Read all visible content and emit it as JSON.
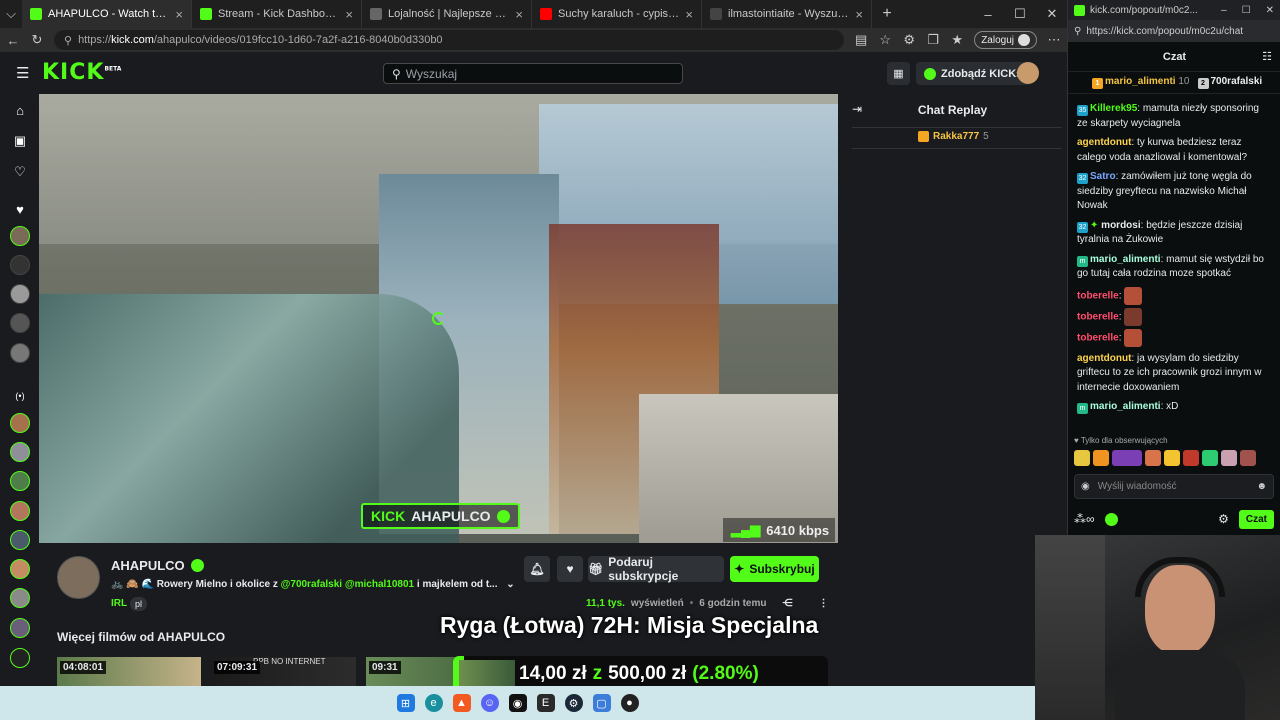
{
  "browser": {
    "tabs": [
      {
        "title": "AHAPULCO - Watch the VOD",
        "active": true,
        "color": "#53fc18"
      },
      {
        "title": "Stream - Kick Dashboard",
        "active": false,
        "color": "#53fc18"
      },
      {
        "title": "Lojalność | Najlepsze oprogramow",
        "active": false,
        "color": "#666666"
      },
      {
        "title": "Suchy karaluch - cypis - YouTube",
        "active": false,
        "color": "#ff0000"
      },
      {
        "title": "ilmastointiaite - Wyszukaj",
        "active": false,
        "color": "#444444"
      }
    ],
    "url": "https://kick.com/ahapulco/videos/019fcc10-1d60-7a2f-a216-8040b0d330b0",
    "url_prefix": "https://",
    "url_domain": "kick.com",
    "url_path": "/ahapulco/videos/019fcc10-1d60-7a2f-a216-8040b0d330b0",
    "login_label": "Zaloguj"
  },
  "header": {
    "logo": "KICK",
    "logo_badge": "BETA",
    "search_placeholder": "Wyszukaj",
    "get_kicks_label": "Zdobądź KICKs"
  },
  "rail": {
    "section_marker": "(•)"
  },
  "video": {
    "watermark": "AHAPULCO",
    "bitrate": "6410 kbps"
  },
  "replay": {
    "title": "Chat Replay",
    "top_user": "Rakka777",
    "top_count": "5"
  },
  "channel": {
    "name": "AHAPULCO",
    "description": "Rowery Mielno i okolice z",
    "mention1": "@700rafalski",
    "mention2": "@michal10801",
    "description_tail": "i majkelem od t...",
    "category": "IRL",
    "language": "pl",
    "gift_label": "Podaruj subskrypcje",
    "subscribe_label": "Subskrybuj",
    "views_value": "11,1 tys.",
    "views_label": "wyświetleń",
    "time_ago": "6 godzin temu",
    "more_videos_title": "Więcej filmów od AHAPULCO",
    "thumbs": [
      {
        "duration": "04:08:01"
      },
      {
        "duration": "07:09:31",
        "caption": "PPB NO INTERNET"
      },
      {
        "duration": "09:31"
      }
    ]
  },
  "overlay": {
    "title": "Ryga (Łotwa) 72H: Misja Specjalna",
    "amount": "14,00 zł",
    "sep": "z",
    "goal": "500,00 zł",
    "percent": "(2.80%)",
    "progress_fraction": 0.028
  },
  "popout": {
    "url": "https://kick.com/popout/m0c2u/chat",
    "window_title": "kick.com/popout/m0c2...",
    "chat_label": "Czat",
    "pinned": [
      {
        "rank": "1",
        "user": "mario_alimenti",
        "count": "10"
      },
      {
        "rank": "2",
        "user": "700rafalski",
        "count": ""
      }
    ],
    "messages": [
      {
        "user": "Killerek95",
        "badge": "35",
        "color": "#53fc18",
        "text": "mamuta niezły sponsoring ze skarpety wyciagnela"
      },
      {
        "user": "agentdonut",
        "badge": "",
        "color": "#fcd34d",
        "text": "ty kurwa bedziesz teraz calego voda anazliowal i komentowal?"
      },
      {
        "user": "Satro",
        "badge": "32",
        "color": "#7aa7ff",
        "text": "zamówiłem już tonę węgla do siedziby greyftecu na nazwisko Michał Nowak"
      },
      {
        "user": "mordosi",
        "badge": "32",
        "color": "#e8eaed",
        "text": "będzie jeszcze dzisiaj tyralnia na Żukowie"
      },
      {
        "user": "mario_alimenti",
        "badge": "m",
        "color": "#a8ffde",
        "text": "mamut się wstydził bo go tutaj cała rodzina moze spotkać"
      },
      {
        "user": "toberelle",
        "badge": "",
        "color": "#ff4d6d",
        "text": ""
      },
      {
        "user": "toberelle",
        "badge": "",
        "color": "#ff4d6d",
        "text": ""
      },
      {
        "user": "toberelle",
        "badge": "",
        "color": "#ff4d6d",
        "text": ""
      },
      {
        "user": "agentdonut",
        "badge": "",
        "color": "#fcd34d",
        "text": "ja wysylam do siedziby griftecu to ze ich pracownik grozi innym w internecie doxowaniem"
      },
      {
        "user": "mario_alimenti",
        "badge": "m",
        "color": "#a8ffde",
        "text": "xD"
      }
    ],
    "followers_only": "Tylko dla obserwujących",
    "input_placeholder": "Wyślij wiadomość",
    "send_label": "Czat"
  }
}
